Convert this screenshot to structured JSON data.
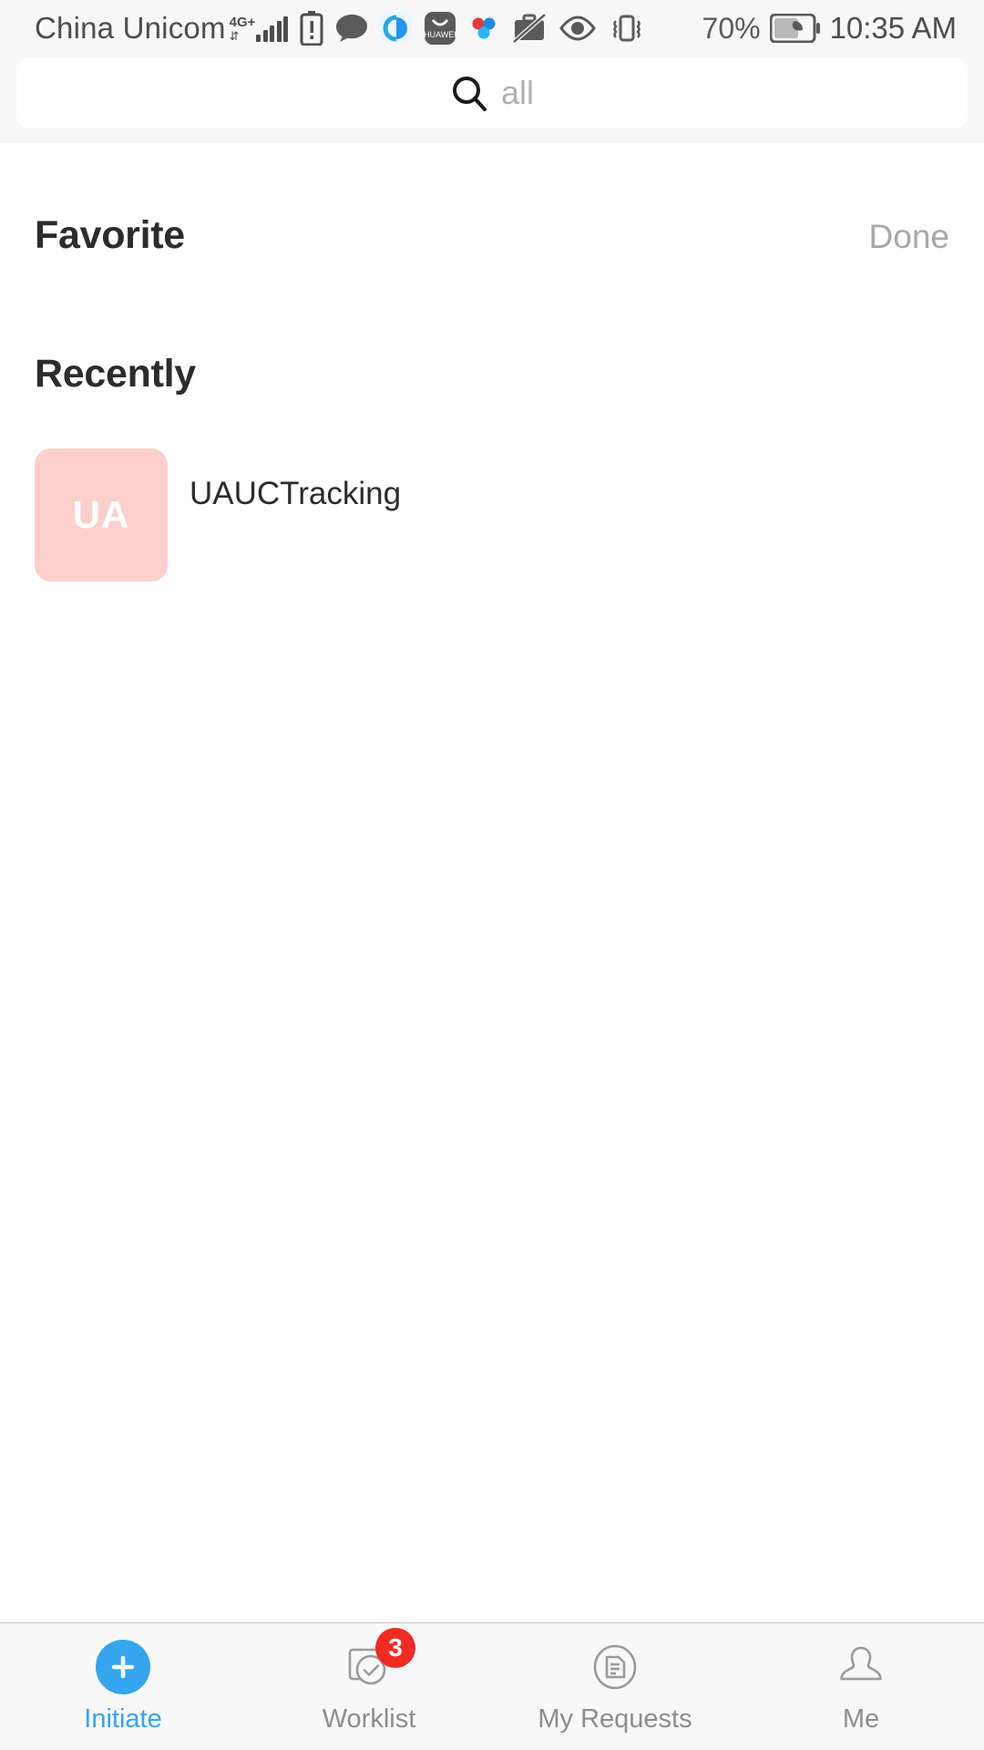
{
  "status_bar": {
    "carrier": "China Unicom",
    "network_type": "4G+",
    "battery_percent": "70%",
    "time": "10:35 AM",
    "icons": [
      "signal-bars-icon",
      "battery-alert-icon",
      "message-bubble-icon",
      "browser-icon",
      "huawei-appgallery-icon",
      "cloud-sync-icon",
      "work-mode-off-icon",
      "eye-comfort-icon",
      "vibrate-icon",
      "power-saving-battery-icon"
    ]
  },
  "search": {
    "placeholder": "all",
    "value": "",
    "icon": "search-icon"
  },
  "favorite_section": {
    "title": "Favorite",
    "action_label": "Done",
    "items": []
  },
  "recently_section": {
    "title": "Recently",
    "items": [
      {
        "initials": "UA",
        "label": "UAUCTracking",
        "tile_color": "#fbcfcc",
        "initials_color": "#ffffff"
      }
    ]
  },
  "tabbar": {
    "active_color": "#34a5ee",
    "inactive_color": "#8c8c8c",
    "badge_color": "#f12c25",
    "tabs": [
      {
        "label": "Initiate",
        "icon": "plus-circle-icon",
        "active": true,
        "badge": ""
      },
      {
        "label": "Worklist",
        "icon": "checklist-icon",
        "active": false,
        "badge": "3"
      },
      {
        "label": "My Requests",
        "icon": "document-circle-icon",
        "active": false,
        "badge": ""
      },
      {
        "label": "Me",
        "icon": "person-icon",
        "active": false,
        "badge": ""
      }
    ]
  }
}
